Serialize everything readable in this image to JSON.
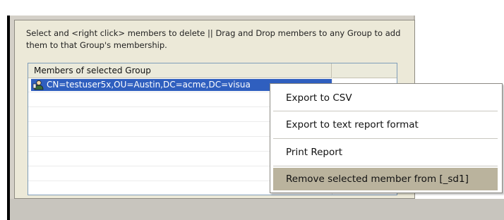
{
  "window": {
    "instructions": "Select and <right click> members to delete || Drag and Drop members to any Group to add them to that Group's membership."
  },
  "members_list": {
    "columns": [
      "Members of selected Group",
      ""
    ],
    "rows": [
      {
        "name": "CN=testuser5x,OU=Austin,DC=acme,DC=visua",
        "selected": true,
        "icon": "user-icon"
      }
    ]
  },
  "context_menu": {
    "items": [
      {
        "label": "Export to CSV",
        "highlighted": false
      },
      {
        "label": "Export to text report format",
        "highlighted": false
      },
      {
        "label": "Print Report",
        "highlighted": false
      },
      {
        "label": "Remove selected member from [_sd1]",
        "highlighted": true
      }
    ]
  },
  "colors": {
    "selection": "#2f5fbf",
    "menu_highlight": "#bab39d",
    "panel": "#ece9d8"
  }
}
